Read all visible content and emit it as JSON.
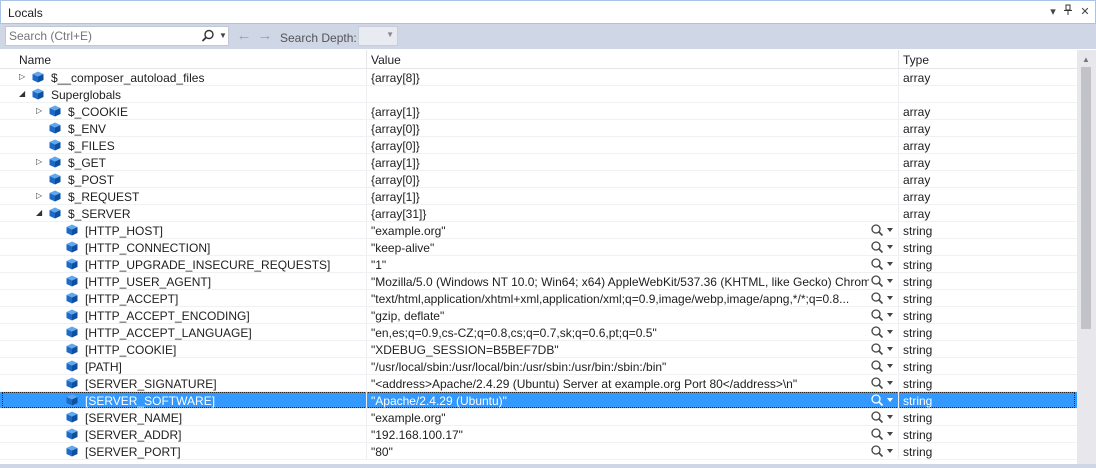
{
  "window": {
    "title": "Locals"
  },
  "toolbar": {
    "search_placeholder": "Search (Ctrl+E)",
    "search_depth_label": "Search Depth:",
    "search_depth_value": ""
  },
  "columns": {
    "name": "Name",
    "value": "Value",
    "type": "Type"
  },
  "rows": [
    {
      "name": "$__composer_autoload_files",
      "value": "{array[8]}",
      "type": "array",
      "level": 0,
      "expander": "collapsed",
      "viz": false,
      "selected": false
    },
    {
      "name": "Superglobals",
      "value": "",
      "type": "",
      "level": 0,
      "expander": "expanded",
      "viz": false,
      "selected": false
    },
    {
      "name": "$_COOKIE",
      "value": "{array[1]}",
      "type": "array",
      "level": 1,
      "expander": "collapsed",
      "viz": false,
      "selected": false
    },
    {
      "name": "$_ENV",
      "value": "{array[0]}",
      "type": "array",
      "level": 1,
      "expander": "none",
      "viz": false,
      "selected": false
    },
    {
      "name": "$_FILES",
      "value": "{array[0]}",
      "type": "array",
      "level": 1,
      "expander": "none",
      "viz": false,
      "selected": false
    },
    {
      "name": "$_GET",
      "value": "{array[1]}",
      "type": "array",
      "level": 1,
      "expander": "collapsed",
      "viz": false,
      "selected": false
    },
    {
      "name": "$_POST",
      "value": "{array[0]}",
      "type": "array",
      "level": 1,
      "expander": "none",
      "viz": false,
      "selected": false
    },
    {
      "name": "$_REQUEST",
      "value": "{array[1]}",
      "type": "array",
      "level": 1,
      "expander": "collapsed",
      "viz": false,
      "selected": false
    },
    {
      "name": "$_SERVER",
      "value": "{array[31]}",
      "type": "array",
      "level": 1,
      "expander": "expanded",
      "viz": false,
      "selected": false
    },
    {
      "name": "[HTTP_HOST]",
      "value": "\"example.org\"",
      "type": "string",
      "level": 2,
      "expander": "none",
      "viz": true,
      "selected": false
    },
    {
      "name": "[HTTP_CONNECTION]",
      "value": "\"keep-alive\"",
      "type": "string",
      "level": 2,
      "expander": "none",
      "viz": true,
      "selected": false
    },
    {
      "name": "[HTTP_UPGRADE_INSECURE_REQUESTS]",
      "value": "\"1\"",
      "type": "string",
      "level": 2,
      "expander": "none",
      "viz": true,
      "selected": false
    },
    {
      "name": "[HTTP_USER_AGENT]",
      "value": "\"Mozilla/5.0 (Windows NT 10.0; Win64; x64) AppleWebKit/537.36 (KHTML, like Gecko) Chrom...",
      "type": "string",
      "level": 2,
      "expander": "none",
      "viz": true,
      "selected": false
    },
    {
      "name": "[HTTP_ACCEPT]",
      "value": "\"text/html,application/xhtml+xml,application/xml;q=0.9,image/webp,image/apng,*/*;q=0.8...",
      "type": "string",
      "level": 2,
      "expander": "none",
      "viz": true,
      "selected": false
    },
    {
      "name": "[HTTP_ACCEPT_ENCODING]",
      "value": "\"gzip, deflate\"",
      "type": "string",
      "level": 2,
      "expander": "none",
      "viz": true,
      "selected": false
    },
    {
      "name": "[HTTP_ACCEPT_LANGUAGE]",
      "value": "\"en,es;q=0.9,cs-CZ;q=0.8,cs;q=0.7,sk;q=0.6,pt;q=0.5\"",
      "type": "string",
      "level": 2,
      "expander": "none",
      "viz": true,
      "selected": false
    },
    {
      "name": "[HTTP_COOKIE]",
      "value": "\"XDEBUG_SESSION=B5BEF7DB\"",
      "type": "string",
      "level": 2,
      "expander": "none",
      "viz": true,
      "selected": false
    },
    {
      "name": "[PATH]",
      "value": "\"/usr/local/sbin:/usr/local/bin:/usr/sbin:/usr/bin:/sbin:/bin\"",
      "type": "string",
      "level": 2,
      "expander": "none",
      "viz": true,
      "selected": false
    },
    {
      "name": "[SERVER_SIGNATURE]",
      "value": "\"<address>Apache/2.4.29 (Ubuntu) Server at example.org Port 80</address>\\n\"",
      "type": "string",
      "level": 2,
      "expander": "none",
      "viz": true,
      "selected": false
    },
    {
      "name": "[SERVER_SOFTWARE]",
      "value": "\"Apache/2.4.29 (Ubuntu)\"",
      "type": "string",
      "level": 2,
      "expander": "none",
      "viz": true,
      "selected": true
    },
    {
      "name": "[SERVER_NAME]",
      "value": "\"example.org\"",
      "type": "string",
      "level": 2,
      "expander": "none",
      "viz": true,
      "selected": false
    },
    {
      "name": "[SERVER_ADDR]",
      "value": "\"192.168.100.17\"",
      "type": "string",
      "level": 2,
      "expander": "none",
      "viz": true,
      "selected": false
    },
    {
      "name": "[SERVER_PORT]",
      "value": "\"80\"",
      "type": "string",
      "level": 2,
      "expander": "none",
      "viz": true,
      "selected": false
    }
  ],
  "colors": {
    "selection": "#3399ff",
    "toolbar": "#cfd6e5",
    "cube": "#1b6ac9"
  },
  "icons": {
    "dropdown": "window-dropdown-icon",
    "pin": "pin-icon",
    "close": "close-icon",
    "search": "search-icon",
    "back": "arrow-left-icon",
    "forward": "arrow-right-icon",
    "variable": "cube-icon",
    "visualizer": "magnifier-icon"
  }
}
